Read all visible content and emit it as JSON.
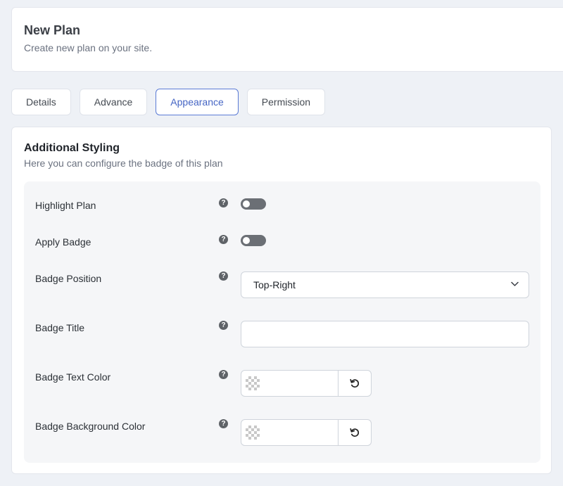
{
  "header": {
    "title": "New Plan",
    "subtitle": "Create new plan on your site."
  },
  "tabs": [
    {
      "label": "Details",
      "active": false
    },
    {
      "label": "Advance",
      "active": false
    },
    {
      "label": "Appearance",
      "active": true
    },
    {
      "label": "Permission",
      "active": false
    }
  ],
  "section": {
    "title": "Additional Styling",
    "description": "Here you can configure the badge of this plan"
  },
  "fields": {
    "highlight_plan": {
      "label": "Highlight Plan",
      "enabled": false
    },
    "apply_badge": {
      "label": "Apply Badge",
      "enabled": false
    },
    "badge_position": {
      "label": "Badge Position",
      "value": "Top-Right"
    },
    "badge_title": {
      "label": "Badge Title",
      "value": ""
    },
    "badge_text_color": {
      "label": "Badge Text Color",
      "value": ""
    },
    "badge_background_color": {
      "label": "Badge Background Color",
      "value": ""
    }
  },
  "icons": {
    "help": "question-circle-icon",
    "chevron": "chevron-down-icon",
    "reset": "undo-icon"
  },
  "colors": {
    "accent": "#4565c4",
    "toggle_off": "#6b6f75",
    "page_bg": "#eef1f6"
  }
}
